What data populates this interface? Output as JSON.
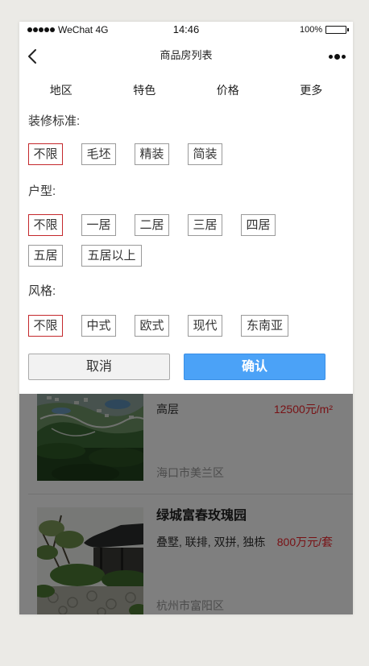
{
  "status_bar": {
    "carrier": "WeChat 4G",
    "time": "14:46",
    "battery": "100%",
    "signal_icon": "signal-strength-icon",
    "battery_icon": "battery-icon"
  },
  "nav": {
    "title": "商品房列表",
    "back_icon": "chevron-left-icon",
    "more_icon": "more-dots-icon"
  },
  "filter_tabs": [
    {
      "label": "地区"
    },
    {
      "label": "特色"
    },
    {
      "label": "价格"
    },
    {
      "label": "更多"
    }
  ],
  "filter_panel": {
    "sections": [
      {
        "title": "装修标准:",
        "options": [
          {
            "label": "不限",
            "selected": true
          },
          {
            "label": "毛坯",
            "selected": false
          },
          {
            "label": "精装",
            "selected": false
          },
          {
            "label": "简装",
            "selected": false
          }
        ]
      },
      {
        "title": "户型:",
        "options": [
          {
            "label": "不限",
            "selected": true
          },
          {
            "label": "一居",
            "selected": false
          },
          {
            "label": "二居",
            "selected": false
          },
          {
            "label": "三居",
            "selected": false
          },
          {
            "label": "四居",
            "selected": false
          },
          {
            "label": "五居",
            "selected": false
          },
          {
            "label": "五居以上",
            "selected": false
          }
        ]
      },
      {
        "title": "风格:",
        "options": [
          {
            "label": "不限",
            "selected": true
          },
          {
            "label": "中式",
            "selected": false
          },
          {
            "label": "欧式",
            "selected": false
          },
          {
            "label": "现代",
            "selected": false
          },
          {
            "label": "东南亚",
            "selected": false
          }
        ]
      }
    ],
    "cancel_label": "取消",
    "confirm_label": "确认"
  },
  "listings": [
    {
      "type": "高层",
      "price": "12500元/m²",
      "location": "海口市美兰区"
    },
    {
      "name": "绿城富春玫瑰园",
      "type": "叠墅, 联排, 双拼, 独栋",
      "price": "800万元/套",
      "location": "杭州市富阳区"
    }
  ],
  "colors": {
    "selected_border": "#c4282c",
    "confirm_button": "#4ba2f7",
    "price": "#f0242b",
    "page_background": "#ebeae6",
    "overlay": "rgba(0,0,0,0.5)"
  }
}
